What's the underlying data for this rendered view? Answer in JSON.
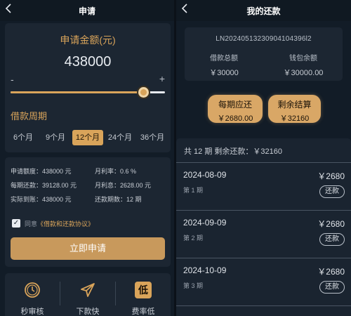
{
  "colors": {
    "accent": "#d9a45a",
    "background": "#121c27",
    "card": "#1c2632"
  },
  "left": {
    "nav": {
      "back_icon": "chevron-left-icon",
      "title": "申请"
    },
    "amount": {
      "label": "申请金额(元)",
      "value": "438000",
      "minus": "-",
      "plus": "+",
      "slider_fraction": 0.86
    },
    "period": {
      "label": "借款周期",
      "options": [
        "6个月",
        "9个月",
        "12个月",
        "24个月",
        "36个月"
      ],
      "selected": "12个月"
    },
    "info": {
      "rows": [
        [
          "申请额度：438000 元",
          "月利率：0.6 %"
        ],
        [
          "每期还款：39128.00 元",
          "月利息：2628.00 元"
        ],
        [
          "实际到账：438000 元",
          "还款期数：12 期"
        ]
      ]
    },
    "agreement": {
      "checked": true,
      "check_mark": "✓",
      "prefix": "同意",
      "link": "《借款和还款协议》"
    },
    "apply_button": "立即申请",
    "features": [
      {
        "icon": "clock-icon",
        "label": "秒审核"
      },
      {
        "icon": "send-icon",
        "label": "下款快"
      },
      {
        "icon": "low-rate-icon",
        "glyph": "低",
        "label": "费率低"
      }
    ]
  },
  "right": {
    "nav": {
      "back_icon": "chevron-left-icon",
      "title": "我的还款"
    },
    "loan": {
      "number": "LN20240513230904104396l2",
      "total_label": "借款总额",
      "total_value": "￥30000",
      "wallet_label": "钱包余额",
      "wallet_value": "￥30000.00"
    },
    "per_period": {
      "label": "每期应还",
      "value": "￥2680.00"
    },
    "settle": {
      "label": "剩余结算",
      "value": "￥32160"
    },
    "schedule_header": "共 12 期 剩余还款：￥32160",
    "schedule": [
      {
        "date": "2024-08-09",
        "amount": "￥2680",
        "term": "第 1 期",
        "button": "还款"
      },
      {
        "date": "2024-09-09",
        "amount": "￥2680",
        "term": "第 2 期",
        "button": "还款"
      },
      {
        "date": "2024-10-09",
        "amount": "￥2680",
        "term": "第 3 期",
        "button": "还款"
      }
    ]
  }
}
